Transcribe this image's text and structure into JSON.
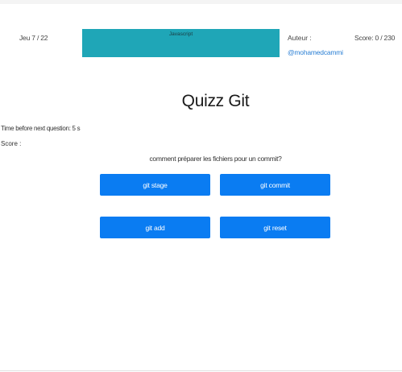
{
  "header": {
    "date": "Jeu 7 / 22",
    "banner_label": "Javascript",
    "author_label": "Auteur :",
    "author_handle": "@mohamedcammi",
    "score_label": "Score: 0 / 230"
  },
  "quiz": {
    "title": "Quizz Git",
    "timer_text": "Time before next question: 5 s",
    "score_text": "Score :",
    "question": "comment préparer les fichiers pour un commit?",
    "answers": [
      {
        "label": "git stage"
      },
      {
        "label": "git commit"
      },
      {
        "label": "git add"
      },
      {
        "label": "git reset"
      }
    ]
  },
  "colors": {
    "banner": "#1fa6b7",
    "button": "#0a7cf2",
    "link": "#2a7fd4"
  }
}
